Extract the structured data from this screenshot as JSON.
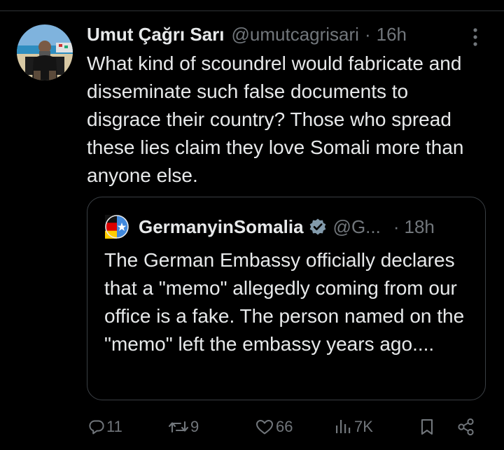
{
  "tweet": {
    "author_name": "Umut Çağrı Sarı",
    "author_handle": "@umutcagrisari",
    "separator": "·",
    "time": "16h",
    "text": "What kind of scoundrel would fabricate and disseminate such false documents to disgrace their country? Those who spread these lies claim they love Somali more than anyone else."
  },
  "quote": {
    "author_name": "GermanyinSomalia",
    "author_handle": "@G...",
    "separator": "·",
    "time": "18h",
    "text": "The German Embassy officially declares that a \"memo\" allegedly coming from our office is a fake. The person named on the \"memo\" left the embassy years ago...."
  },
  "actions": {
    "replies": "11",
    "reposts": "9",
    "likes": "66",
    "views": "7K"
  },
  "icons": {
    "more": "more-vertical-icon",
    "verified": "verified-badge-icon",
    "reply": "reply-icon",
    "repost": "repost-icon",
    "like": "heart-icon",
    "views": "views-chart-icon",
    "bookmark": "bookmark-icon",
    "share": "share-icon"
  },
  "colors": {
    "background": "#000000",
    "text_primary": "#e7e9ea",
    "text_secondary": "#71767b",
    "border": "#3a3f44",
    "verified_badge": "#829aab"
  }
}
